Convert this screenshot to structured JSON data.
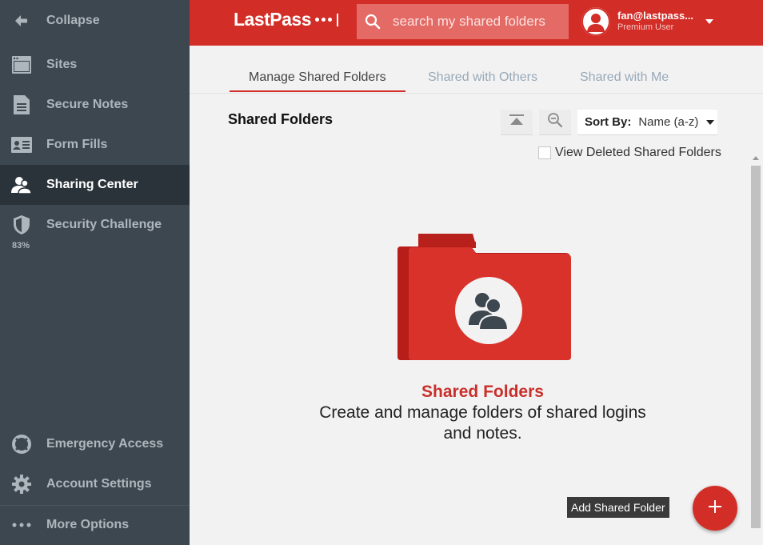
{
  "sidebar": {
    "collapse_label": "Collapse",
    "items": [
      {
        "label": "Sites",
        "icon": "sites-icon"
      },
      {
        "label": "Secure Notes",
        "icon": "notes-icon"
      },
      {
        "label": "Form Fills",
        "icon": "form-fills-icon"
      },
      {
        "label": "Sharing Center",
        "icon": "sharing-icon",
        "active": true
      },
      {
        "label": "Security Challenge",
        "icon": "shield-icon",
        "score": "83%"
      }
    ],
    "bottom_items": [
      {
        "label": "Emergency Access",
        "icon": "lifebuoy-icon"
      },
      {
        "label": "Account Settings",
        "icon": "gear-icon"
      },
      {
        "label": "More Options",
        "icon": "ellipsis-icon"
      }
    ]
  },
  "header": {
    "logo_text": "LastPass",
    "search_placeholder": "search my shared folders",
    "user_email": "fan@lastpass...",
    "user_tier": "Premium User"
  },
  "tabs": [
    {
      "label": "Manage Shared Folders",
      "active": true
    },
    {
      "label": "Shared with Others"
    },
    {
      "label": "Shared with Me"
    }
  ],
  "toolbar": {
    "title": "Shared Folders",
    "sort_label": "Sort By:",
    "sort_value": "Name (a-z)",
    "view_deleted_label": "View Deleted Shared Folders"
  },
  "empty_state": {
    "title": "Shared Folders",
    "description": "Create and manage folders of shared logins and notes."
  },
  "fab": {
    "tooltip": "Add Shared Folder"
  },
  "colors": {
    "brand_red": "#d32d27",
    "sidebar_bg": "#3d4750",
    "sidebar_active_bg": "#2b333a"
  }
}
